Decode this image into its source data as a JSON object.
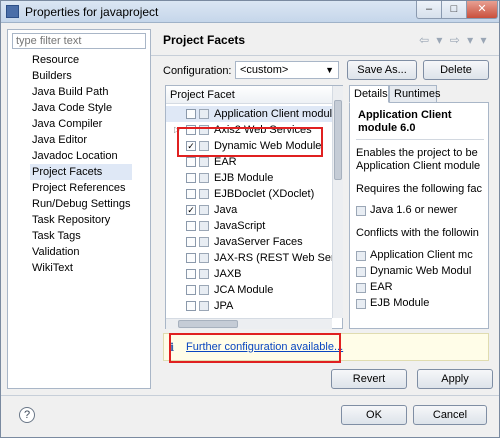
{
  "window": {
    "title": "Properties for javaproject",
    "min_glyph": "–",
    "max_glyph": "□",
    "close_glyph": "✕"
  },
  "filter": {
    "placeholder": "type filter text"
  },
  "nav": {
    "items": [
      "Resource",
      "Builders",
      "Java Build Path",
      "Java Code Style",
      "Java Compiler",
      "Java Editor",
      "Javadoc Location",
      "Project Facets",
      "Project References",
      "Run/Debug Settings",
      "Task Repository",
      "Task Tags",
      "Validation",
      "WikiText"
    ],
    "selected": "Project Facets"
  },
  "page": {
    "title": "Project Facets",
    "nav_arrows": "⇦ ▾ ⇨ ▾ ▾"
  },
  "configuration": {
    "label": "Configuration:",
    "value": "<custom>",
    "save_as": "Save As...",
    "delete": "Delete"
  },
  "facets": {
    "header": "Project Facet",
    "rows": [
      {
        "name": "Application Client module",
        "checked": false,
        "twisty": false
      },
      {
        "name": "Axis2 Web Services",
        "checked": false,
        "twisty": true
      },
      {
        "name": "Dynamic Web Module",
        "checked": true,
        "twisty": false
      },
      {
        "name": "EAR",
        "checked": false,
        "twisty": false
      },
      {
        "name": "EJB Module",
        "checked": false,
        "twisty": false
      },
      {
        "name": "EJBDoclet (XDoclet)",
        "checked": false,
        "twisty": false
      },
      {
        "name": "Java",
        "checked": true,
        "twisty": false
      },
      {
        "name": "JavaScript",
        "checked": false,
        "twisty": false
      },
      {
        "name": "JavaServer Faces",
        "checked": false,
        "twisty": false
      },
      {
        "name": "JAX-RS (REST Web Servic",
        "checked": false,
        "twisty": false
      },
      {
        "name": "JAXB",
        "checked": false,
        "twisty": false
      },
      {
        "name": "JCA Module",
        "checked": false,
        "twisty": false
      },
      {
        "name": "JPA",
        "checked": false,
        "twisty": false
      }
    ]
  },
  "details": {
    "tab_details": "Details",
    "tab_runtimes": "Runtimes",
    "title": "Application Client module 6.0",
    "line1": "Enables the project to be",
    "line2": "Application Client module",
    "requires": "Requires the following fac",
    "req_item": "Java 1.6 or newer",
    "conflicts": "Conflicts with the followin",
    "conflict_items": [
      "Application Client mc",
      "Dynamic Web Modul",
      "EAR",
      "EJB Module"
    ]
  },
  "info": {
    "icon": "i",
    "link": "Further configuration available..."
  },
  "buttons": {
    "revert": "Revert",
    "apply": "Apply",
    "ok": "OK",
    "cancel": "Cancel",
    "help": "?"
  }
}
